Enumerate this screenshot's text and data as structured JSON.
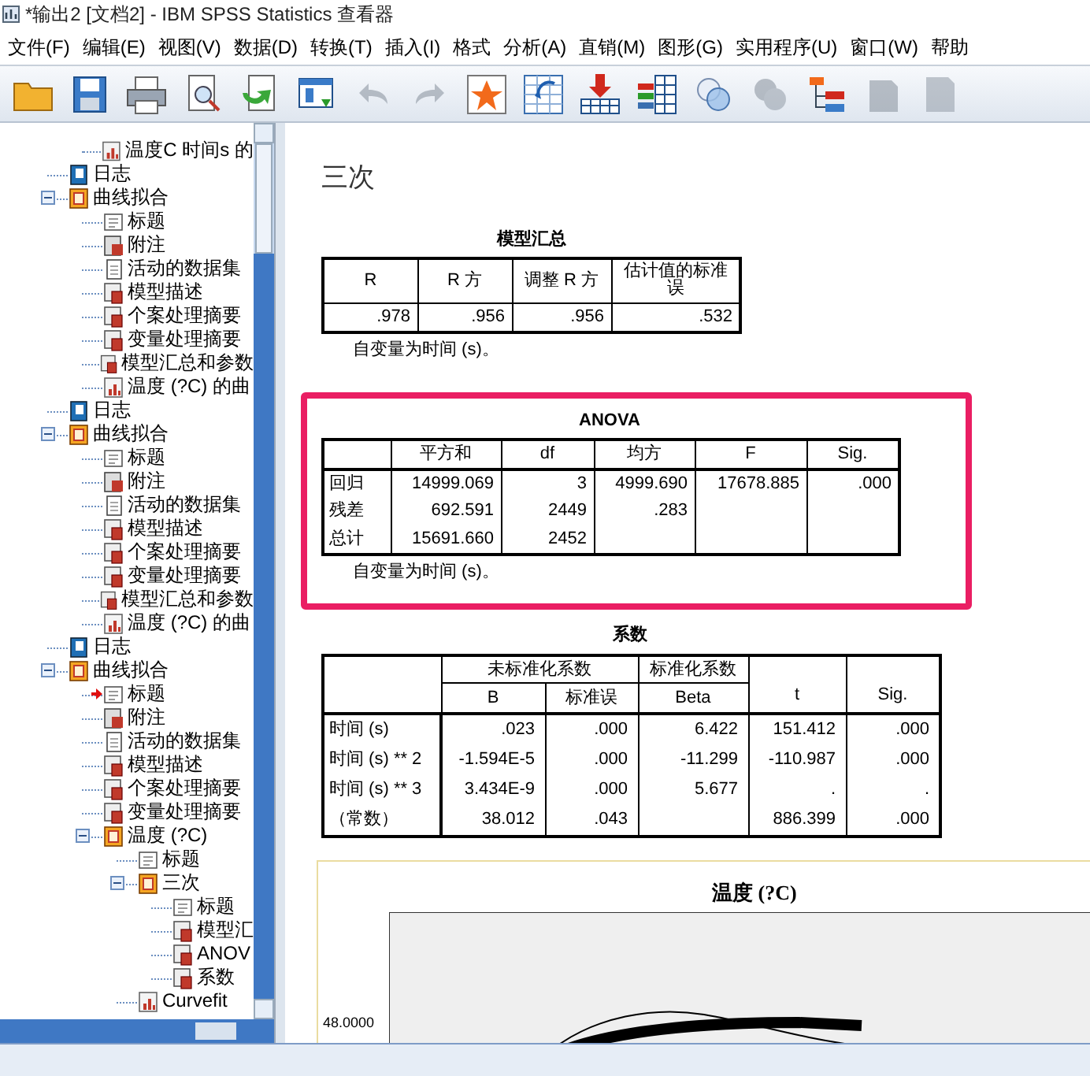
{
  "window": {
    "title": "*输出2 [文档2] - IBM SPSS Statistics 查看器"
  },
  "menu": [
    "文件(F)",
    "编辑(E)",
    "视图(V)",
    "数据(D)",
    "转换(T)",
    "插入(I)",
    "格式",
    "分析(A)",
    "直销(M)",
    "图形(G)",
    "实用程序(U)",
    "窗口(W)",
    "帮助"
  ],
  "outline": [
    {
      "children": [
        {
          "label": "温度C 时间s 的",
          "kind": "chart",
          "current": false
        }
      ]
    },
    {
      "label": "日志",
      "kind": "log",
      "current": false
    },
    {
      "label": "曲线拟合",
      "kind": "group",
      "current": false,
      "expanded": true,
      "children": [
        {
          "label": "标题",
          "kind": "title",
          "current": false
        },
        {
          "label": "附注",
          "kind": "note",
          "current": false
        },
        {
          "label": "活动的数据集",
          "kind": "text",
          "current": false
        },
        {
          "label": "模型描述",
          "kind": "table",
          "current": false
        },
        {
          "label": "个案处理摘要",
          "kind": "table",
          "current": false
        },
        {
          "label": "变量处理摘要",
          "kind": "table",
          "current": false
        },
        {
          "label": "模型汇总和参数",
          "kind": "table",
          "current": false
        },
        {
          "label": "温度 (?C) 的曲",
          "kind": "chart",
          "current": false
        }
      ]
    },
    {
      "label": "日志",
      "kind": "log",
      "current": false
    },
    {
      "label": "曲线拟合",
      "kind": "group",
      "current": false,
      "expanded": true,
      "children": [
        {
          "label": "标题",
          "kind": "title",
          "current": false
        },
        {
          "label": "附注",
          "kind": "note",
          "current": false
        },
        {
          "label": "活动的数据集",
          "kind": "text",
          "current": false
        },
        {
          "label": "模型描述",
          "kind": "table",
          "current": false
        },
        {
          "label": "个案处理摘要",
          "kind": "table",
          "current": false
        },
        {
          "label": "变量处理摘要",
          "kind": "table",
          "current": false
        },
        {
          "label": "模型汇总和参数",
          "kind": "table",
          "current": false
        },
        {
          "label": "温度 (?C) 的曲",
          "kind": "chart",
          "current": false
        }
      ]
    },
    {
      "label": "日志",
      "kind": "log",
      "current": false
    },
    {
      "label": "曲线拟合",
      "kind": "group",
      "current": false,
      "expanded": true,
      "children": [
        {
          "label": "标题",
          "kind": "title",
          "current": true
        },
        {
          "label": "附注",
          "kind": "note",
          "current": false
        },
        {
          "label": "活动的数据集",
          "kind": "text",
          "current": false
        },
        {
          "label": "模型描述",
          "kind": "table",
          "current": false
        },
        {
          "label": "个案处理摘要",
          "kind": "table",
          "current": false
        },
        {
          "label": "变量处理摘要",
          "kind": "table",
          "current": false
        },
        {
          "label": "温度 (?C)",
          "kind": "group",
          "current": false,
          "expanded": true,
          "children": [
            {
              "label": "标题",
              "kind": "title",
              "current": false
            },
            {
              "label": "三次",
              "kind": "group",
              "current": false,
              "expanded": true,
              "children": [
                {
                  "label": "标题",
                  "kind": "title",
                  "current": false
                },
                {
                  "label": "模型汇",
                  "kind": "table",
                  "current": false
                },
                {
                  "label": "ANOV",
                  "kind": "table",
                  "current": false
                },
                {
                  "label": "系数",
                  "kind": "table",
                  "current": false
                }
              ]
            },
            {
              "label": "Curvefit",
              "kind": "chart",
              "current": false
            }
          ]
        }
      ]
    }
  ],
  "content": {
    "heading": "三次",
    "model_summary": {
      "title": "模型汇总",
      "columns": [
        "R",
        "R 方",
        "调整 R 方",
        "估计值的标准误"
      ],
      "rows": [
        [
          ".978",
          ".956",
          ".956",
          ".532"
        ]
      ],
      "footnote": "自变量为时间 (s)。"
    },
    "anova": {
      "title": "ANOVA",
      "highlighted": true,
      "columns": [
        "平方和",
        "df",
        "均方",
        "F",
        "Sig."
      ],
      "rows": [
        {
          "label": "回归",
          "cells": [
            "14999.069",
            "3",
            "4999.690",
            "17678.885",
            ".000"
          ]
        },
        {
          "label": "残差",
          "cells": [
            "692.591",
            "2449",
            ".283",
            null,
            null
          ]
        },
        {
          "label": "总计",
          "cells": [
            "15691.660",
            "2452",
            null,
            null,
            null
          ]
        }
      ],
      "footnote": "自变量为时间 (s)。"
    },
    "coefficients": {
      "title": "系数",
      "group_headers": [
        {
          "label": "未标准化系数",
          "columns": [
            "B",
            "标准误"
          ]
        },
        {
          "label": "标准化系数",
          "columns": [
            "Beta"
          ]
        }
      ],
      "plain_columns": [
        "t",
        "Sig."
      ],
      "rows": [
        {
          "label": "时间 (s)",
          "cells": [
            ".023",
            ".000",
            "6.422",
            "151.412",
            ".000"
          ]
        },
        {
          "label": "时间 (s) ** 2",
          "cells": [
            "-1.594E-5",
            ".000",
            "-11.299",
            "-110.987",
            ".000"
          ]
        },
        {
          "label": "时间 (s) ** 3",
          "cells": [
            "3.434E-9",
            ".000",
            "5.677",
            ".",
            "."
          ]
        },
        {
          "label": "（常数）",
          "cells": [
            "38.012",
            ".043",
            null,
            "886.399",
            ".000"
          ]
        }
      ]
    },
    "chart": {
      "title": "温度 (?C)",
      "ytick_label": "48.0000"
    }
  }
}
